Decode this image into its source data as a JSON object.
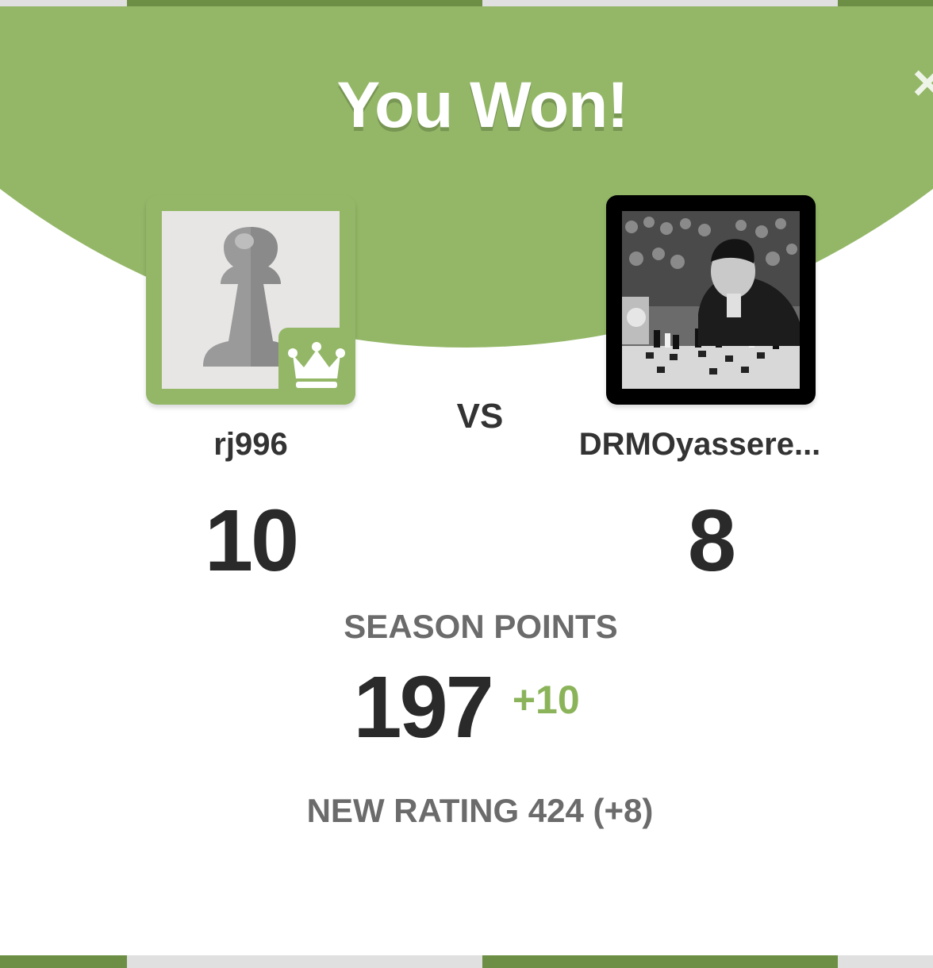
{
  "header": {
    "title": "You Won!",
    "close_label": "×"
  },
  "player": {
    "name": "rj996",
    "score": "10",
    "avatar": "pawn-avatar",
    "badge": "crown-icon"
  },
  "opponent": {
    "name": "DRMOyassere...",
    "score": "8",
    "avatar": "chess-player-photo"
  },
  "vs_label": "VS",
  "season": {
    "label": "SEASON POINTS",
    "value": "197",
    "delta": "+10"
  },
  "rating": {
    "text": "NEW RATING 424 (+8)"
  },
  "colors": {
    "accent_green": "#93b767",
    "delta_green": "#8bb45a",
    "text_dark": "#2a2a2a",
    "text_gray": "#6b6b6b"
  }
}
